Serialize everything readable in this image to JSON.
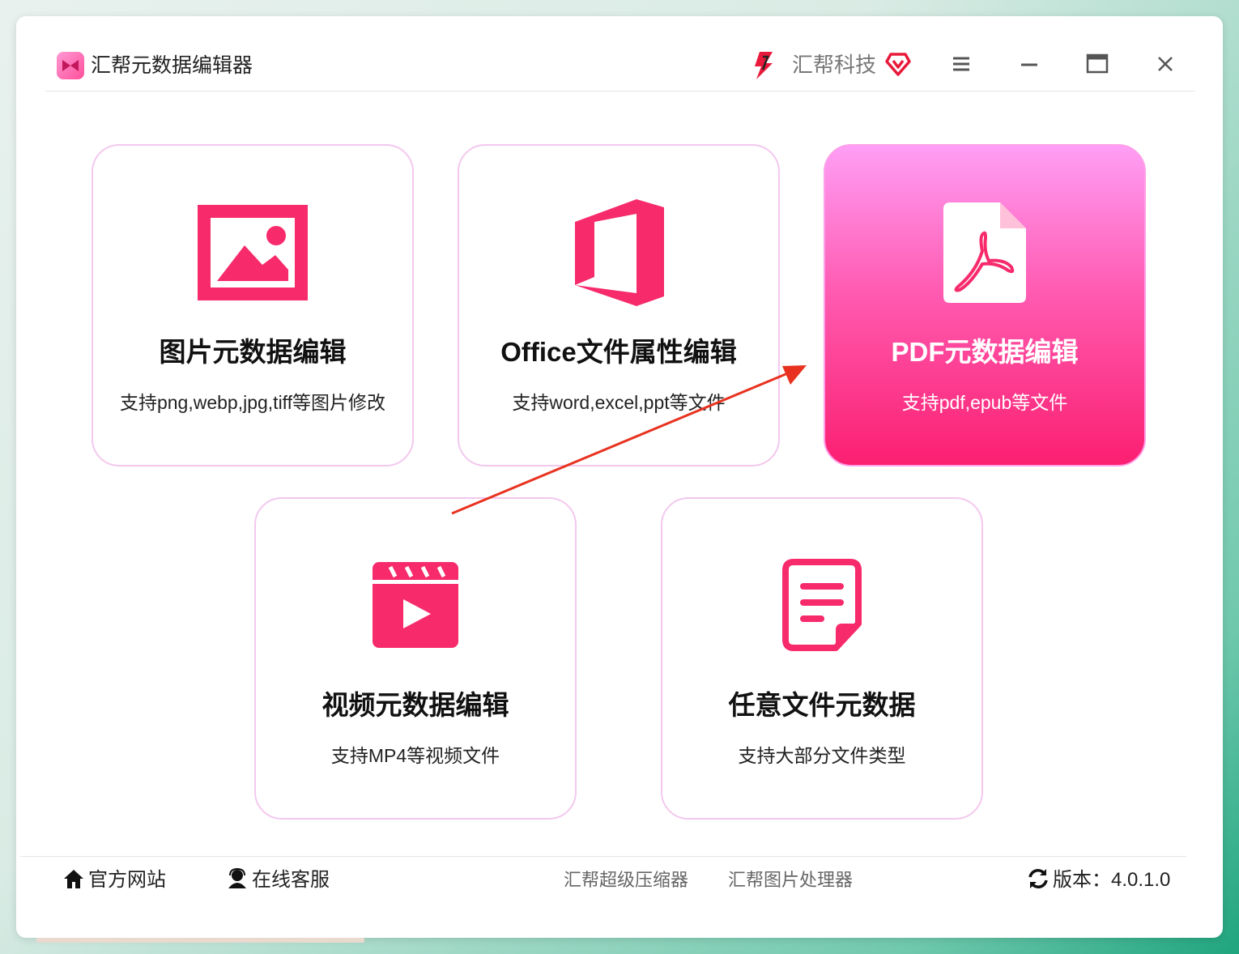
{
  "window": {
    "app_title": "汇帮元数据编辑器",
    "brand_name": "汇帮科技",
    "brand_color": "#e8193a",
    "buttons": [
      "menu-icon",
      "minimize-icon",
      "maximize-icon",
      "close-icon"
    ]
  },
  "accent_color": "#f72a6c",
  "cards": [
    {
      "title": "图片元数据编辑",
      "subtitle": "支持png,webp,jpg,tiff等图片修改",
      "icon": "image-icon",
      "active": false
    },
    {
      "title": "Office文件属性编辑",
      "subtitle": "支持word,excel,ppt等文件",
      "icon": "office-icon",
      "active": false
    },
    {
      "title": "PDF元数据编辑",
      "subtitle": "支持pdf,epub等文件",
      "icon": "pdf-icon",
      "active": true
    },
    {
      "title": "视频元数据编辑",
      "subtitle": "支持MP4等视频文件",
      "icon": "video-icon",
      "active": false
    },
    {
      "title": "任意文件元数据",
      "subtitle": "支持大部分文件类型",
      "icon": "document-icon",
      "active": false
    }
  ],
  "footer": {
    "website": "官方网站",
    "support": "在线客服",
    "link1": "汇帮超级压缩器",
    "link2": "汇帮图片处理器",
    "version": "版本：4.0.1.0"
  }
}
